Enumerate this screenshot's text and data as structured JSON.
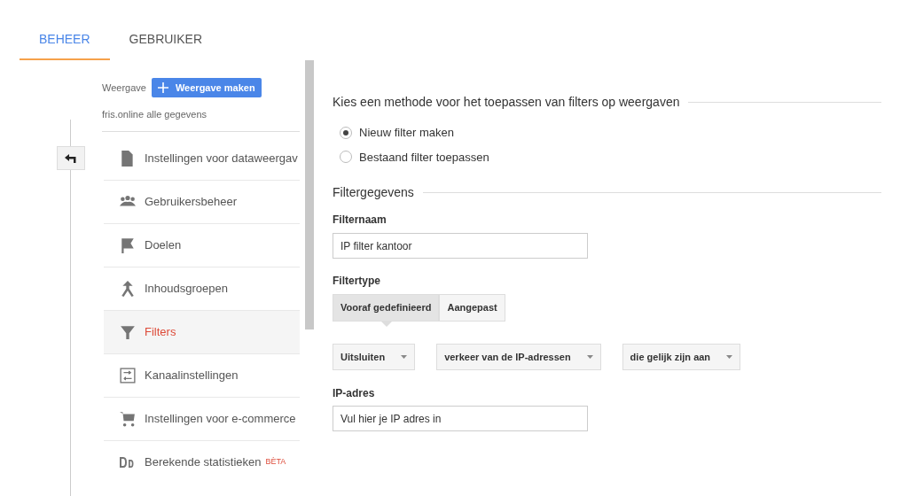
{
  "tabs": [
    {
      "label": "BEHEER",
      "selected": true
    },
    {
      "label": "GEBRUIKER",
      "selected": false
    }
  ],
  "view": {
    "label": "Weergave",
    "create_button": "Weergave maken",
    "name": "fris.online alle gegevens"
  },
  "sidebar": {
    "items": [
      {
        "label": "Instellingen voor dataweergav",
        "selected": false
      },
      {
        "label": "Gebruikersbeheer",
        "selected": false
      },
      {
        "label": "Doelen",
        "selected": false
      },
      {
        "label": "Inhoudsgroepen",
        "selected": false
      },
      {
        "label": "Filters",
        "selected": true
      },
      {
        "label": "Kanaalinstellingen",
        "selected": false
      },
      {
        "label": "Instellingen voor e-commerce",
        "selected": false
      },
      {
        "label": "Berekende statistieken",
        "badge": "BÈTA",
        "selected": false
      }
    ]
  },
  "method": {
    "heading": "Kies een methode voor het toepassen van filters op weergaven",
    "options": [
      {
        "label": "Nieuw filter maken",
        "selected": true
      },
      {
        "label": "Bestaand filter toepassen",
        "selected": false
      }
    ]
  },
  "filter_details": {
    "heading": "Filtergegevens",
    "name_label": "Filternaam",
    "name_value": "IP filter kantoor",
    "type_label": "Filtertype",
    "type_tabs": [
      {
        "label": "Vooraf gedefinieerd",
        "selected": true
      },
      {
        "label": "Aangepast",
        "selected": false
      }
    ],
    "dropdowns": [
      "Uitsluiten",
      "verkeer van de IP-adressen",
      "die gelijk zijn aan"
    ],
    "ip_label": "IP-adres",
    "ip_value": "Vul hier je IP adres in"
  }
}
